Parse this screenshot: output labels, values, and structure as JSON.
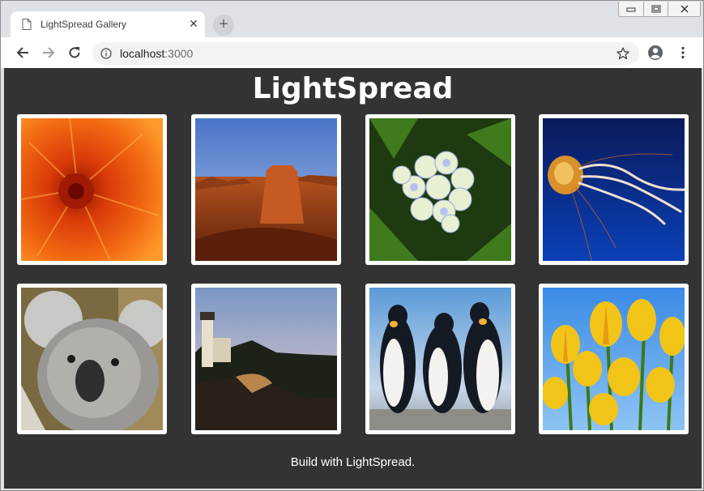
{
  "browser": {
    "tab_title": "LightSpread Gallery",
    "tab_close_glyph": "✕",
    "new_tab_glyph": "+",
    "url_host": "localhost",
    "url_port": ":3000",
    "icons": [
      "file-icon",
      "close-icon",
      "plus-icon",
      "back-arrow-icon",
      "forward-arrow-icon",
      "reload-icon",
      "info-icon",
      "star-icon",
      "account-icon",
      "kebab-menu-icon",
      "minimize-icon",
      "restore-icon",
      "window-close-icon"
    ]
  },
  "page": {
    "title": "LightSpread",
    "footer": "Build with LightSpread.",
    "background_color": "#333333",
    "gallery": [
      {
        "name": "orange-flower-thumbnail",
        "subject": "orange chrysanthemum"
      },
      {
        "name": "desert-mesa-thumbnail",
        "subject": "desert butte"
      },
      {
        "name": "hydrangea-thumbnail",
        "subject": "white hydrangea"
      },
      {
        "name": "jellyfish-thumbnail",
        "subject": "jellyfish"
      },
      {
        "name": "koala-thumbnail",
        "subject": "koala"
      },
      {
        "name": "lighthouse-thumbnail",
        "subject": "lighthouse at dusk"
      },
      {
        "name": "penguins-thumbnail",
        "subject": "penguins"
      },
      {
        "name": "tulips-thumbnail",
        "subject": "yellow tulips"
      }
    ]
  }
}
